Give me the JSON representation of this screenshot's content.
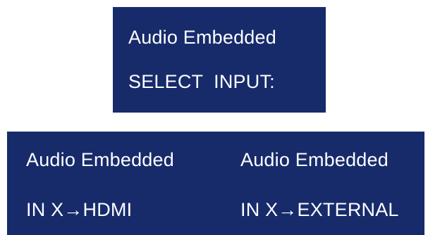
{
  "screen_top": {
    "line1": "Audio Embedded",
    "line2": "SELECT  INPUT:"
  },
  "screen_bottom": {
    "left": {
      "line1": "Audio Embedded",
      "line2": "IN X→HDMI"
    },
    "right": {
      "line1": "Audio Embedded",
      "line2": "IN X→EXTERNAL"
    }
  },
  "colors": {
    "lcd_background": "#172b6b",
    "lcd_text": "#ffffff"
  }
}
